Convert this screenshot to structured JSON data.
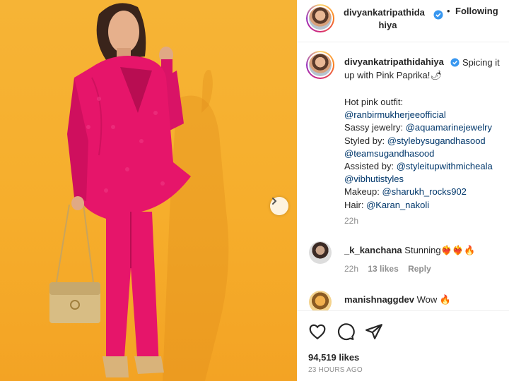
{
  "post_image": {
    "next_icon": "chevron-right-icon"
  },
  "header": {
    "username_line1": "divyankatripathida",
    "username_line2": "hiya",
    "dot": "•",
    "follow_label": "Following",
    "verified_icon": "verified-badge-icon"
  },
  "caption": {
    "username": "divyankatripathidahiya",
    "text_part1": "Spicing it",
    "text_part2": "up with Pink Paprika!🌶",
    "lines": [
      {
        "prefix": "Hot pink outfit:",
        "mention": ""
      },
      {
        "prefix": "",
        "mention": "@ranbirmukherjeeofficial"
      },
      {
        "prefix": "Sassy jewelry: ",
        "mention": "@aquamarinejewelry"
      },
      {
        "prefix": "Styled by: ",
        "mention": "@stylebysugandhasood"
      },
      {
        "prefix": "",
        "mention": "@teamsugandhasood"
      },
      {
        "prefix": "Assisted by: ",
        "mention": "@styleitupwithmicheala"
      },
      {
        "prefix": "",
        "mention": "@vibhutistyles"
      },
      {
        "prefix": "Makeup: ",
        "mention": "@sharukh_rocks902"
      },
      {
        "prefix": "Hair: ",
        "mention": "@Karan_nakoli"
      }
    ],
    "time": "22h"
  },
  "comments": [
    {
      "username": "_k_kanchana",
      "text": "Stunning❤️‍🔥❤️‍🔥🔥",
      "time": "22h",
      "likes": "13 likes",
      "reply": "Reply"
    },
    {
      "username": "manishnaggdev",
      "text": "Wow 🔥"
    }
  ],
  "actions": {
    "like_icon": "heart-icon",
    "comment_icon": "comment-icon",
    "share_icon": "send-icon",
    "likes_count": "94,519 likes",
    "posted_ago": "23 HOURS AGO"
  },
  "colors": {
    "background_yellow": "#f6b436",
    "outfit_pink": "#e6156a",
    "mention_blue": "#00376b",
    "verified_blue": "#3897f0",
    "muted_gray": "#8e8e8e"
  }
}
